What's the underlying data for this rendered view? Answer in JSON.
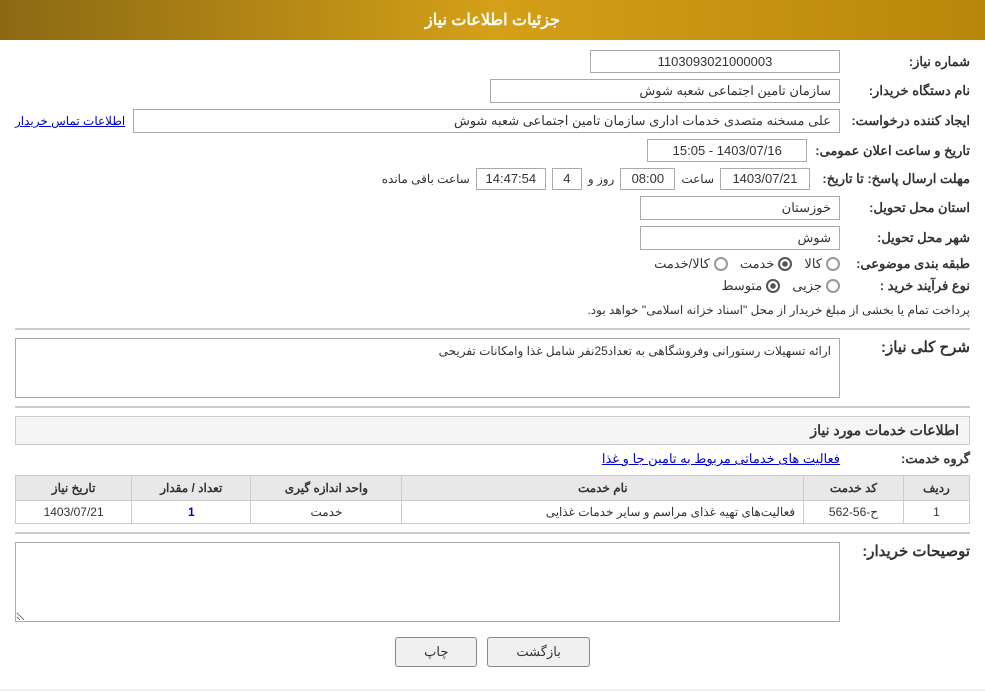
{
  "header": {
    "title": "جزئیات اطلاعات نیاز"
  },
  "fields": {
    "need_number_label": "شماره نیاز:",
    "need_number_value": "1103093021000003",
    "buyer_org_label": "نام دستگاه خریدار:",
    "buyer_org_value": "سازمان تامین اجتماعی شعبه شوش",
    "creator_label": "ایجاد کننده درخواست:",
    "creator_value": "علی مسخنه متصدی خدمات اداری سازمان تامین اجتماعی شعبه شوش",
    "contact_link": "اطلاعات تماس خریدار",
    "publish_date_label": "تاریخ و ساعت اعلان عمومی:",
    "publish_date_value": "1403/07/16 - 15:05",
    "response_deadline_label": "مهلت ارسال پاسخ: تا تاریخ:",
    "response_date": "1403/07/21",
    "response_time_label": "ساعت",
    "response_time": "08:00",
    "response_days_label": "روز و",
    "response_days": "4",
    "response_remaining_label": "ساعت باقی مانده",
    "response_remaining": "14:47:54",
    "province_label": "استان محل تحویل:",
    "province_value": "خوزستان",
    "city_label": "شهر محل تحویل:",
    "city_value": "شوش",
    "category_label": "طبقه بندی موضوعی:",
    "category_options": [
      "کالا",
      "خدمت",
      "کالا/خدمت"
    ],
    "category_selected": "خدمت",
    "purchase_type_label": "نوع فرآیند خرید :",
    "purchase_type_options": [
      "جزیی",
      "متوسط"
    ],
    "purchase_type_selected": "متوسط",
    "purchase_note": "پرداخت تمام یا بخشی از مبلغ خریدار از محل \"اسناد خزانه اسلامی\" خواهد بود.",
    "description_label": "شرح کلی نیاز:",
    "description_value": "ارائه تسهیلات رستورانی وفروشگاهی به تعداد25نفر شامل غذا وامکانات تفریحی",
    "services_section_title": "اطلاعات خدمات مورد نیاز",
    "service_group_label": "گروه خدمت:",
    "service_group_value": "فعالیت های خدماتی مربوط به تامین جا و غذا",
    "table": {
      "columns": [
        "ردیف",
        "کد خدمت",
        "نام خدمت",
        "واحد اندازه گیری",
        "تعداد / مقدار",
        "تاریخ نیاز"
      ],
      "rows": [
        {
          "row": "1",
          "code": "ح-56-562",
          "name": "فعالیت‌های تهیه غذای مراسم و سایر خدمات غذایی",
          "unit": "خدمت",
          "quantity": "1",
          "date": "1403/07/21"
        }
      ]
    },
    "buyer_notes_label": "توصیحات خریدار:"
  },
  "buttons": {
    "print": "چاپ",
    "back": "بازگشت"
  }
}
